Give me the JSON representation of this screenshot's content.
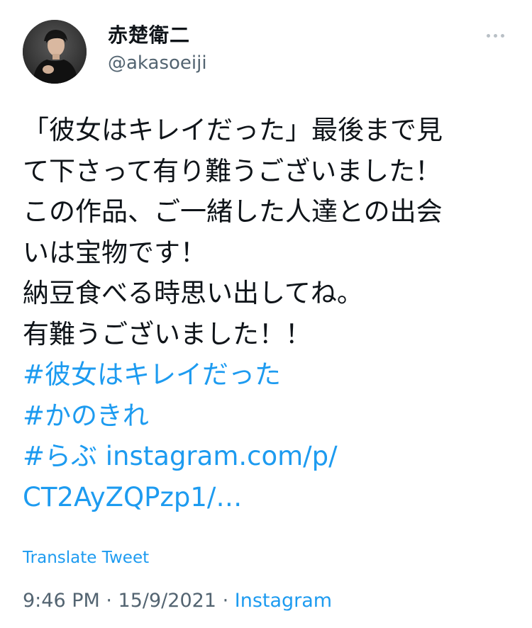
{
  "user": {
    "display_name": "赤楚衛二",
    "handle": "@akasoeiji"
  },
  "icons": {
    "more": "more-horizontal-icon"
  },
  "tweet": {
    "lines": [
      "「彼女はキレイだった」最後まで見",
      "て下さって有り難うございました！",
      "この作品、ご一緒した人達との出会",
      "いは宝物です！",
      "納豆食べる時思い出してね。",
      "有難うございました！！"
    ],
    "hashtags": [
      "#彼女はキレイだった",
      "#かのきれ",
      "#らぶ instagram.com/p/",
      "CT2AyZQPzp1/…"
    ]
  },
  "translate_label": "Translate Tweet",
  "meta": {
    "time": "9:46 PM",
    "separator": " · ",
    "date": "15/9/2021",
    "source": "Instagram"
  },
  "colors": {
    "link": "#1d9bf0",
    "secondary_text": "#536471",
    "primary_text": "#0f1419"
  }
}
